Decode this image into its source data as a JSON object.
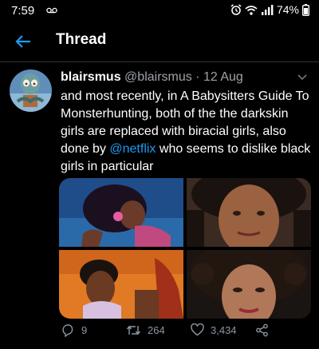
{
  "status_bar": {
    "time": "7:59",
    "battery": "74%"
  },
  "header": {
    "title": "Thread"
  },
  "tweet": {
    "name": "blairsmus",
    "handle": "@blairsmus",
    "separator": "·",
    "date": "12 Aug",
    "text_before": "and most recently, in A Babysitters Guide To Monsterhunting, both of the the darkskin girls are replaced with biracial girls, also done by ",
    "mention": "@netflix",
    "text_after": " who seems to dislike black girls in particular",
    "replies": "9",
    "retweets": "264",
    "likes": "3,434"
  },
  "icons": [
    "back-arrow-icon",
    "reply-icon",
    "retweet-icon",
    "like-icon",
    "share-icon",
    "chevron-down-icon",
    "alarm-icon",
    "wifi-icon",
    "signal-icon",
    "battery-icon",
    "voicemail-icon"
  ],
  "colors": {
    "background": "#000000",
    "accent": "#1d9bf0",
    "muted": "#8b98a5",
    "divider": "#2f3336"
  }
}
